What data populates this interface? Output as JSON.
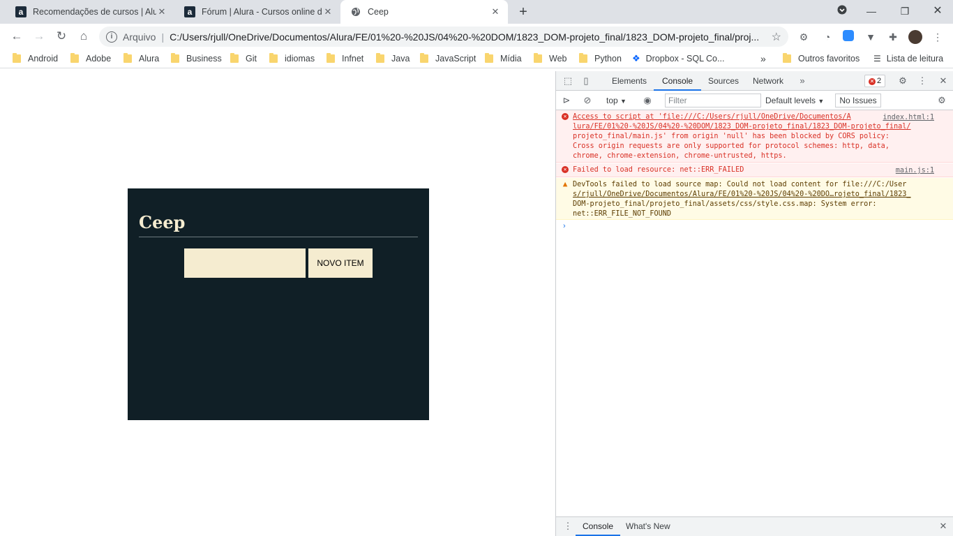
{
  "tabs": [
    {
      "title": "Recomendações de cursos | Alura",
      "favicon": "alura-icon"
    },
    {
      "title": "Fórum | Alura - Cursos online de",
      "favicon": "alura-icon"
    },
    {
      "title": "Ceep",
      "favicon": "globe-icon"
    }
  ],
  "address": {
    "protocol_label": "Arquivo",
    "url": "C:/Users/rjull/OneDrive/Documentos/Alura/FE/01%20-%20JS/04%20-%20DOM/1823_DOM-projeto_final/1823_DOM-projeto_final/proj..."
  },
  "bookmarks": [
    "Android",
    "Adobe",
    "Alura",
    "Business",
    "Git",
    "idiomas",
    "Infnet",
    "Java",
    "JavaScript",
    "Mídia",
    "Web",
    "Python",
    "Dropbox - SQL Co..."
  ],
  "bookmarks_right": {
    "more": "»",
    "other": "Outros favoritos",
    "reading": "Lista de leitura"
  },
  "app": {
    "brand": "Ceep",
    "button_label": "NOVO ITEM",
    "input_value": "",
    "background": "#101f26",
    "accent": "#f5ecd0"
  },
  "devtools": {
    "tabs": [
      "Elements",
      "Console",
      "Sources",
      "Network"
    ],
    "active_tab": "Console",
    "error_count": "2",
    "context": "top",
    "filter_placeholder": "Filter",
    "levels": "Default levels",
    "issues": "No Issues",
    "messages": [
      {
        "level": "error",
        "source": "index.html:1",
        "lines": [
          "Access to script at 'file:///C:/Users/rjull/OneDrive/Documentos/A",
          "lura/FE/01%20-%20JS/04%20-%20DOM/1823_DOM-projeto_final/1823_DOM-projeto_final/",
          "projeto_final/main.js' from origin 'null' has been blocked by CORS policy:",
          "Cross origin requests are only supported for protocol schemes: http, data,",
          "chrome, chrome-extension, chrome-untrusted, https."
        ]
      },
      {
        "level": "error",
        "source": "main.js:1",
        "lines": [
          "Failed to load resource: net::ERR_FAILED"
        ]
      },
      {
        "level": "warning",
        "source": "",
        "lines": [
          "DevTools failed to load source map: Could not load content for file:///C:/User",
          "s/rjull/OneDrive/Documentos/Alura/FE/01%20-%20JS/04%20-%20DO…rojeto_final/1823_",
          "DOM-projeto_final/projeto_final/assets/css/style.css.map: System error:",
          "net::ERR_FILE_NOT_FOUND"
        ]
      }
    ],
    "drawer_tabs": [
      "Console",
      "What's New"
    ]
  }
}
